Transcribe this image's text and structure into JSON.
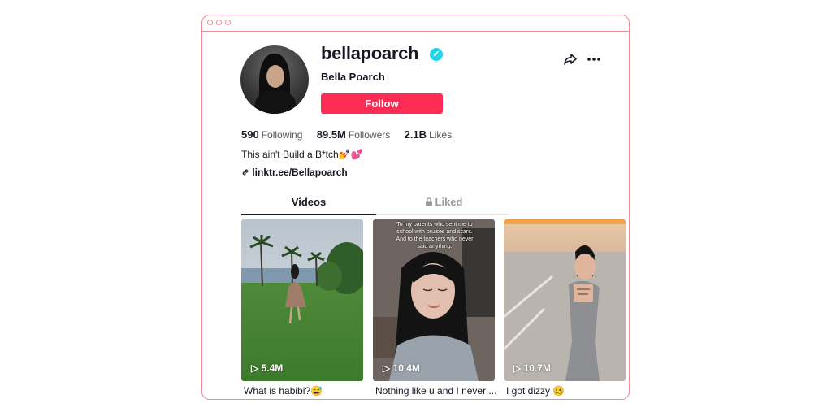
{
  "profile": {
    "username": "bellapoarch",
    "display_name": "Bella Poarch",
    "follow_label": "Follow",
    "verified_mark": "✓",
    "bio": "This ain't Build a B*tch💅💕",
    "link": "linktr.ee/Bellapoarch"
  },
  "stats": [
    {
      "value": "590",
      "label": "Following"
    },
    {
      "value": "89.5M",
      "label": "Followers"
    },
    {
      "value": "2.1B",
      "label": "Likes"
    }
  ],
  "tabs": {
    "videos": "Videos",
    "liked": "Liked"
  },
  "videos": [
    {
      "views": "5.4M",
      "caption": "What is habibi?😅"
    },
    {
      "views": "10.4M",
      "caption": "Nothing like u and I never ...",
      "overlay": "To my parents who sent me to school with bruises and scars. And to the teachers who never said anything."
    },
    {
      "views": "10.7M",
      "caption": "I got dizzy 🥴"
    }
  ],
  "colors": {
    "accent": "#fe2c55",
    "verified": "#20d5ec",
    "frame": "#f08a97"
  },
  "icons": [
    "share-icon",
    "more-icon",
    "verified-icon",
    "link-icon",
    "lock-icon",
    "play-icon"
  ]
}
